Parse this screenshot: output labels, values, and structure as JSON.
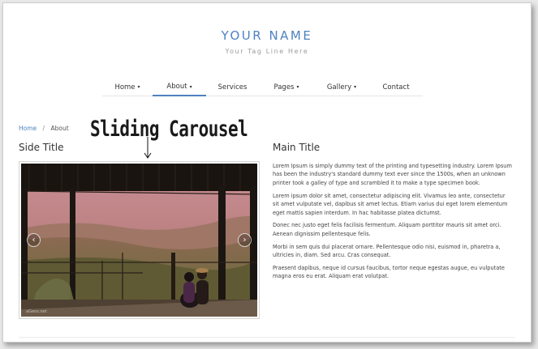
{
  "header": {
    "site_name": "YOUR NAME",
    "tagline": "Your Tag Line Here"
  },
  "nav": {
    "items": [
      {
        "label": "Home",
        "dropdown": true
      },
      {
        "label": "About",
        "dropdown": true,
        "active": true
      },
      {
        "label": "Services",
        "dropdown": false
      },
      {
        "label": "Pages",
        "dropdown": true
      },
      {
        "label": "Gallery",
        "dropdown": true
      },
      {
        "label": "Contact",
        "dropdown": false
      }
    ],
    "caret": "▾",
    "accent_color": "#4e82c2"
  },
  "breadcrumb": {
    "home": "Home",
    "separator": "/",
    "current": "About"
  },
  "annotation": {
    "label": "Sliding Carousel"
  },
  "sidebar": {
    "title": "Side Title"
  },
  "carousel": {
    "prev_icon": "‹",
    "next_icon": "›",
    "watermark": "aGens.net"
  },
  "main": {
    "title": "Main Title",
    "paragraphs": [
      "Lorem Ipsum is simply dummy text of the printing and typesetting industry. Lorem Ipsum has been the industry's standard dummy text ever since the 1500s, when an unknown printer took a galley of type and scrambled it to make a type specimen book.",
      "Lorem ipsum dolor sit amet, consectetur adipiscing elit. Vivamus leo ante, consectetur sit amet vulputate vel, dapibus sit amet lectus. Etiam varius dui eget lorem elementum eget mattis sapien interdum. In hac habitasse platea dictumst.",
      "Donec nec justo eget felis facilisis fermentum. Aliquam porttitor mauris sit amet orci. Aenean dignissim pellentesque felis.",
      "Morbi in sem quis dui placerat ornare. Pellentesque odio nisi, euismod in, pharetra a, ultricies in, diam. Sed arcu. Cras consequat.",
      "Praesent dapibus, neque id cursus faucibus, tortor neque egestas augue, eu vulputate magna eros eu erat. Aliquam erat volutpat."
    ]
  }
}
